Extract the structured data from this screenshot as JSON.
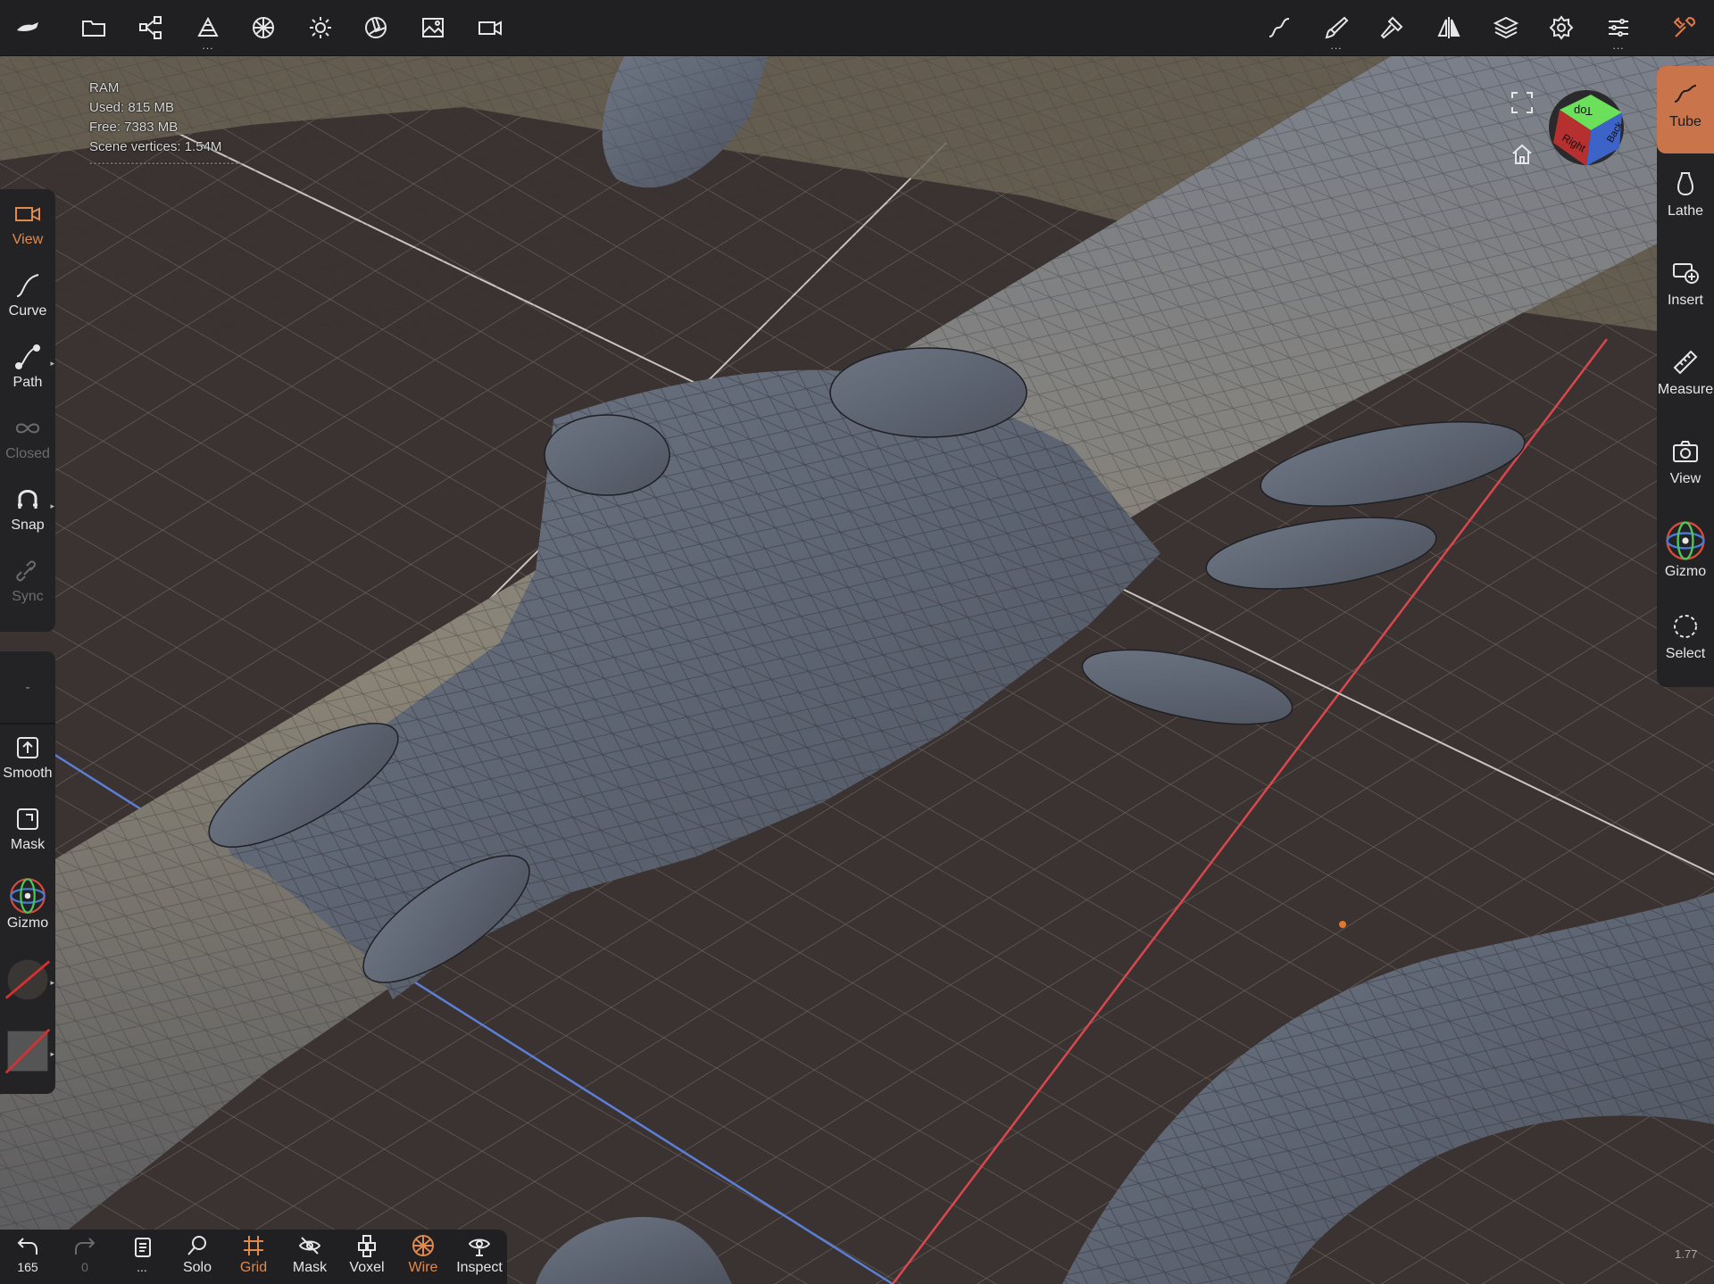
{
  "topbar": {
    "left_icons": [
      "logo-icon",
      "folder-icon",
      "scene-graph-icon",
      "primitives-icon",
      "material-icon",
      "light-icon",
      "postprocess-icon",
      "background-image-icon",
      "camera-video-icon"
    ],
    "right_icons": [
      "stroke-icon",
      "brush-icon",
      "hammer-icon",
      "symmetry-icon",
      "layers-icon",
      "settings-icon",
      "sliders-icon",
      "tools-icon"
    ]
  },
  "stats": {
    "ram_label": "RAM",
    "used": "Used: 815 MB",
    "free": "Free: 7383 MB",
    "vertices": "Scene vertices: 1.54M",
    "separator": "-------------------------------------"
  },
  "left_tools": [
    {
      "label": "View",
      "icon": "camera-icon",
      "state": "active"
    },
    {
      "label": "Curve",
      "icon": "curve-icon",
      "state": "normal"
    },
    {
      "label": "Path",
      "icon": "path-icon",
      "state": "normal"
    },
    {
      "label": "Closed",
      "icon": "infinity-icon",
      "state": "disabled"
    },
    {
      "label": "Snap",
      "icon": "magnet-icon",
      "state": "normal"
    },
    {
      "label": "Sync",
      "icon": "link-icon",
      "state": "disabled"
    }
  ],
  "left_lower": {
    "blank": "-",
    "smooth": "Smooth",
    "mask": "Mask",
    "gizmo": "Gizmo"
  },
  "right_tools": [
    {
      "label": "Tube",
      "icon": "tube-icon",
      "state": "active"
    },
    {
      "label": "Lathe",
      "icon": "lathe-icon",
      "state": "normal"
    },
    {
      "label": "Insert",
      "icon": "insert-icon",
      "state": "normal"
    },
    {
      "label": "Measure",
      "icon": "ruler-icon",
      "state": "normal"
    },
    {
      "label": "View",
      "icon": "camera-icon",
      "state": "normal"
    },
    {
      "label": "Gizmo",
      "icon": "gizmo-icon",
      "state": "normal"
    },
    {
      "label": "Select",
      "icon": "lasso-select-icon",
      "state": "normal"
    }
  ],
  "view_cube": {
    "top": "Top",
    "right": "Right",
    "back": "Back"
  },
  "bottombar": {
    "undo_count": "165",
    "redo_count": "0",
    "more": "...",
    "solo": "Solo",
    "grid": "Grid",
    "mask": "Mask",
    "voxel": "Voxel",
    "wire": "Wire",
    "inspect": "Inspect"
  },
  "corner_value": "1.77",
  "colors": {
    "accent": "#e08a4e",
    "panel": "#232325",
    "mesh": "#6a7280",
    "floor": "#3a3230",
    "x_axis": "#d8484e",
    "y_axis": "#5b7fd6"
  }
}
